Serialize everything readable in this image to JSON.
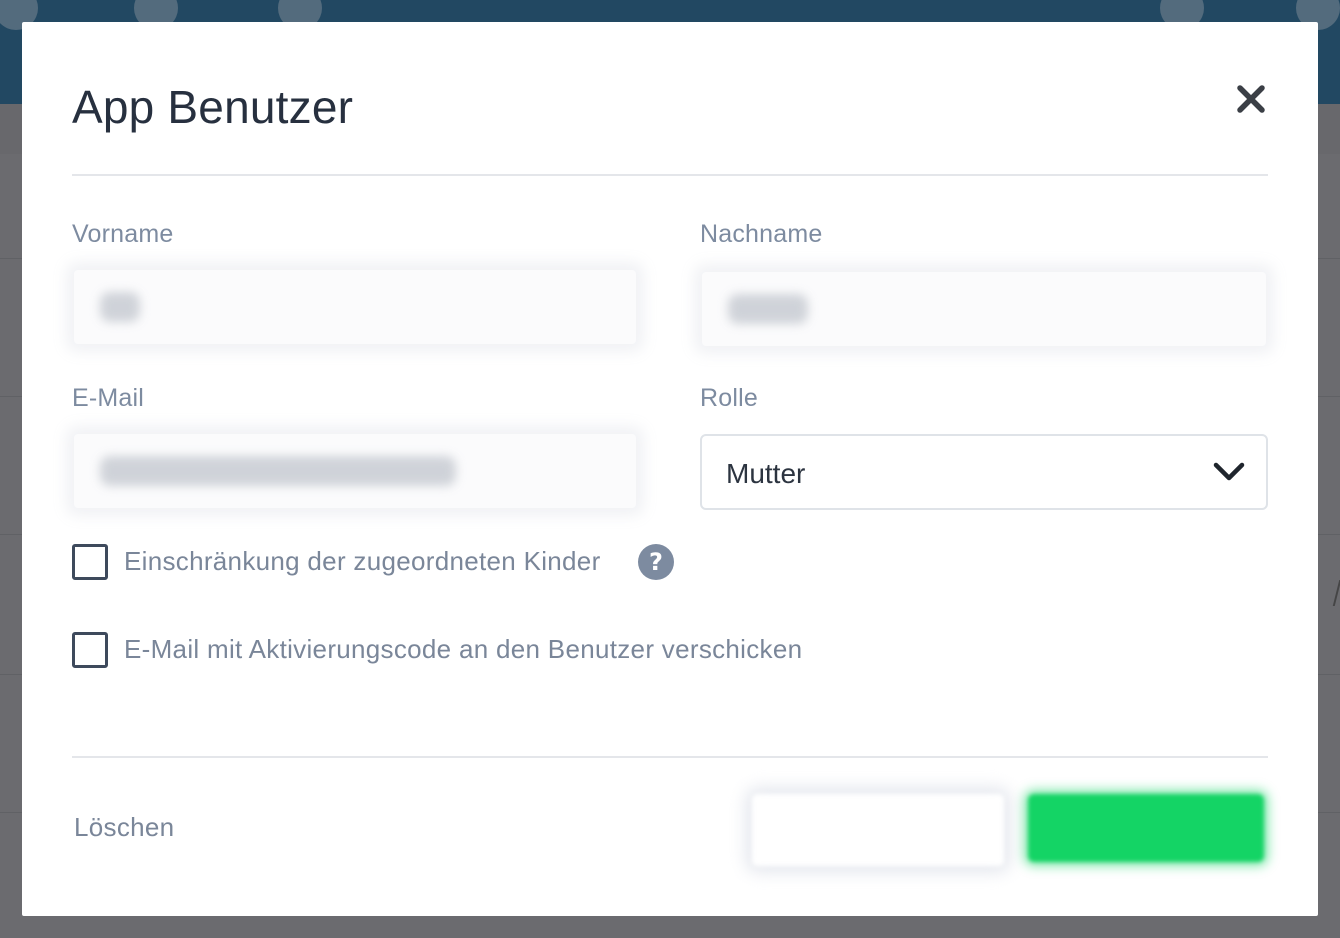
{
  "modal": {
    "title": "App Benutzer"
  },
  "form": {
    "first_name": {
      "label": "Vorname",
      "value": ""
    },
    "last_name": {
      "label": "Nachname",
      "value": ""
    },
    "email": {
      "label": "E-Mail",
      "value": ""
    },
    "role": {
      "label": "Rolle",
      "selected": "Mutter"
    }
  },
  "checkboxes": {
    "restrict_children": {
      "label": "Einschränkung der zugeordneten Kinder",
      "checked": false
    },
    "send_activation_email": {
      "label": "E-Mail mit Aktivierungscode an den Benutzer verschicken",
      "checked": false
    }
  },
  "footer": {
    "delete_label": "Löschen",
    "cancel_label": "",
    "save_label": ""
  },
  "icons": {
    "close": "close-icon",
    "chevron": "chevron-down-icon",
    "help": "question-circle-icon",
    "help_glyph": "?"
  },
  "colors": {
    "save_button": "#14d465",
    "topbar": "#1f5a80",
    "label_text": "#7d8ba0"
  }
}
